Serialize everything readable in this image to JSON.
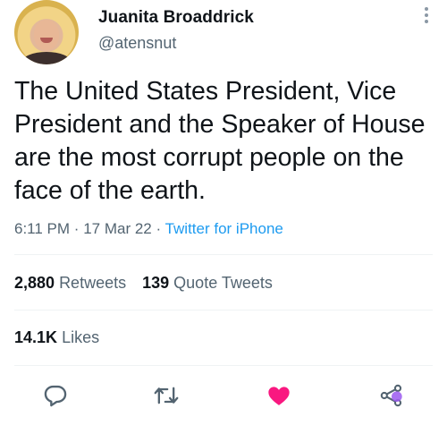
{
  "user": {
    "display_name": "Juanita Broaddrick",
    "handle": "@atensnut"
  },
  "tweet": {
    "text": "The United States President, Vice President and the Speaker of House are the most corrupt people on the face of the earth.",
    "time": "6:11 PM",
    "separator": "·",
    "date": "17 Mar 22",
    "source": "Twitter for iPhone"
  },
  "stats": {
    "retweets_count": "2,880",
    "retweets_label": "Retweets",
    "quotes_count": "139",
    "quotes_label": "Quote Tweets",
    "likes_count": "14.1K",
    "likes_label": "Likes"
  },
  "actions": {
    "reply_icon": "reply-icon",
    "retweet_icon": "retweet-icon",
    "like_icon": "heart-icon",
    "like_color": "#f91880",
    "share_icon": "share-icon",
    "icon_color": "#536471"
  }
}
